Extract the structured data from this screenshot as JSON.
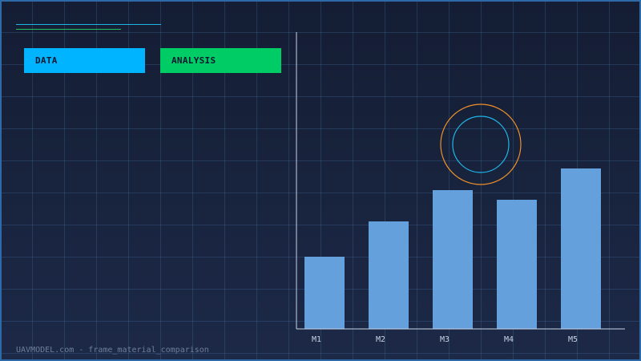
{
  "tags": {
    "data": "DATA",
    "analysis": "ANALYSIS"
  },
  "footer": "UAVMODEL.com - frame_material_comparison",
  "colors": {
    "bar": "#64a0dc",
    "axis": "#c8d2e6",
    "ring_outer": "#f0902a",
    "ring_inner": "#1fb6e8"
  },
  "chart_data": {
    "type": "bar",
    "categories": [
      "M1",
      "M2",
      "M3",
      "M4",
      "M5"
    ],
    "values": [
      90,
      134,
      173,
      161,
      200
    ],
    "ylim": [
      0,
      370
    ],
    "grid": true,
    "legend": "none"
  }
}
